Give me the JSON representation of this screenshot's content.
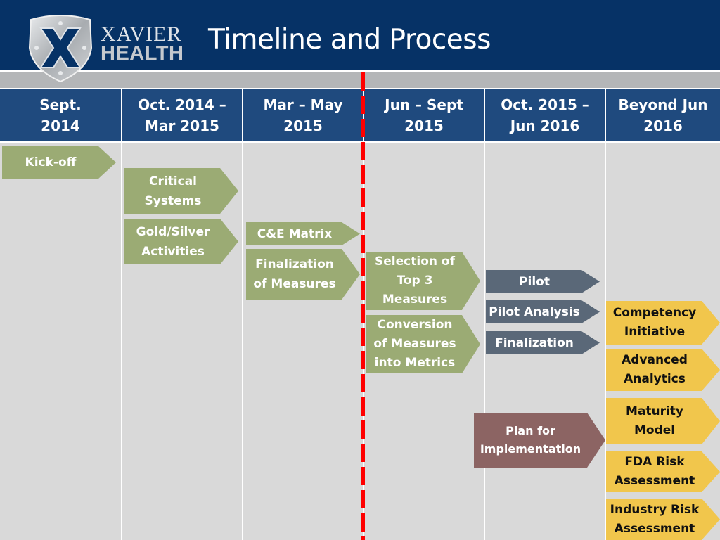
{
  "slide": {
    "title": "Timeline and Process",
    "logo": {
      "line1": "XAVIER",
      "line2": "HEALTH",
      "icon": "shield-x-icon"
    }
  },
  "colors": {
    "header_navy": "#063266",
    "column_header": "#1f4a7e",
    "body_gray": "#d9d9d9",
    "green": "#9bab74",
    "slate": "#5a6878",
    "mauve": "#8c6463",
    "yellow": "#f1c64c",
    "marker_red": "#ff0000"
  },
  "columns": [
    {
      "line1": "Sept.",
      "line2": "2014"
    },
    {
      "line1": "Oct. 2014 –",
      "line2": "Mar 2015"
    },
    {
      "line1": "Mar – May",
      "line2": "2015"
    },
    {
      "line1": "Jun – Sept",
      "line2": "2015"
    },
    {
      "line1": "Oct. 2015 –",
      "line2": "Jun 2016"
    },
    {
      "line1": "Beyond Jun",
      "line2": "2016"
    }
  ],
  "tasks": [
    {
      "label": "Kick-off",
      "column": 0,
      "status_color": "green"
    },
    {
      "label": "Critical Systems",
      "column": 1,
      "status_color": "green"
    },
    {
      "label": "Gold/Silver Activities",
      "column": 1,
      "status_color": "green"
    },
    {
      "label": "C&E Matrix",
      "column": 2,
      "status_color": "green"
    },
    {
      "label": "Finalization of Measures",
      "column": 2,
      "status_color": "green"
    },
    {
      "label": "Selection of Top 3 Measures",
      "column": 3,
      "status_color": "green"
    },
    {
      "label": "Conversion of Measures into Metrics",
      "column": 3,
      "status_color": "green"
    },
    {
      "label": "Pilot",
      "column": 4,
      "status_color": "slate"
    },
    {
      "label": "Pilot Analysis",
      "column": 4,
      "status_color": "slate"
    },
    {
      "label": "Finalization",
      "column": 4,
      "status_color": "slate"
    },
    {
      "label": "Plan for Implementation",
      "column": 4,
      "status_color": "mauve"
    },
    {
      "label": "Competency Initiative",
      "column": 5,
      "status_color": "yellow"
    },
    {
      "label": "Advanced Analytics",
      "column": 5,
      "status_color": "yellow"
    },
    {
      "label": "Maturity Model",
      "column": 5,
      "status_color": "yellow"
    },
    {
      "label": "FDA Risk Assessment",
      "column": 5,
      "status_color": "yellow"
    },
    {
      "label": "Industry Risk Assessment",
      "column": 5,
      "status_color": "yellow"
    }
  ],
  "labels": {
    "kickoff": [
      "Kick-off"
    ],
    "critical": [
      "Critical",
      "Systems"
    ],
    "goldsilver": [
      "Gold/Silver",
      "Activities"
    ],
    "ce": [
      "C&E Matrix"
    ],
    "finmeasures": [
      "Finalization",
      "of Measures"
    ],
    "selection": [
      "Selection of",
      "Top 3",
      "Measures"
    ],
    "conversion": [
      "Conversion",
      "of Measures",
      "into Metrics"
    ],
    "pilot": [
      "Pilot"
    ],
    "pilotanalysis": [
      "Pilot Analysis"
    ],
    "finalization": [
      "Finalization"
    ],
    "plan": [
      "Plan for",
      "Implementation"
    ],
    "competency": [
      "Competency",
      "Initiative"
    ],
    "advanced": [
      "Advanced",
      "Analytics"
    ],
    "maturity": [
      "Maturity",
      "Model"
    ],
    "fda": [
      "FDA Risk",
      "Assessment"
    ],
    "industry": [
      "Industry Risk",
      "Assessment"
    ]
  },
  "current_marker": {
    "label": "current date marker",
    "between_columns": [
      "Mar – May 2015",
      "Jun – Sept 2015"
    ]
  }
}
